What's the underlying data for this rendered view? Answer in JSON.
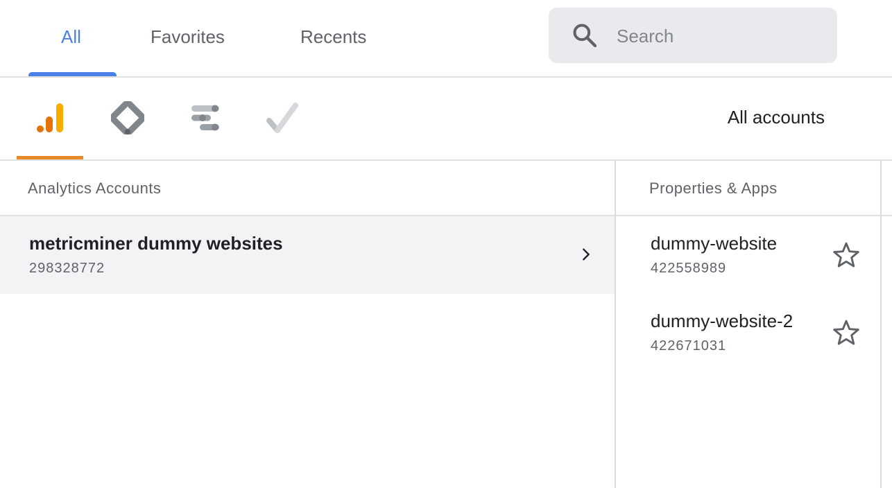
{
  "tabs": [
    {
      "label": "All",
      "active": true
    },
    {
      "label": "Favorites",
      "active": false
    },
    {
      "label": "Recents",
      "active": false
    }
  ],
  "search": {
    "placeholder": "Search",
    "icon": "search-icon"
  },
  "products": [
    {
      "name": "analytics-icon",
      "selected": true
    },
    {
      "name": "tag-manager-icon",
      "selected": false
    },
    {
      "name": "data-studio-icon",
      "selected": false
    },
    {
      "name": "optimize-icon",
      "selected": false
    }
  ],
  "accounts_filter": "All accounts",
  "columns": {
    "accounts_header": "Analytics Accounts",
    "properties_header": "Properties & Apps"
  },
  "accounts": [
    {
      "name": "metricminer dummy websites",
      "id": "298328772"
    }
  ],
  "properties": [
    {
      "name": "dummy-website",
      "id": "422558989"
    },
    {
      "name": "dummy-website-2",
      "id": "422671031"
    }
  ],
  "colors": {
    "accent_blue": "#4a80e8",
    "analytics_orange": "#e37400",
    "selected_row_bg": "#f1f3f4"
  }
}
